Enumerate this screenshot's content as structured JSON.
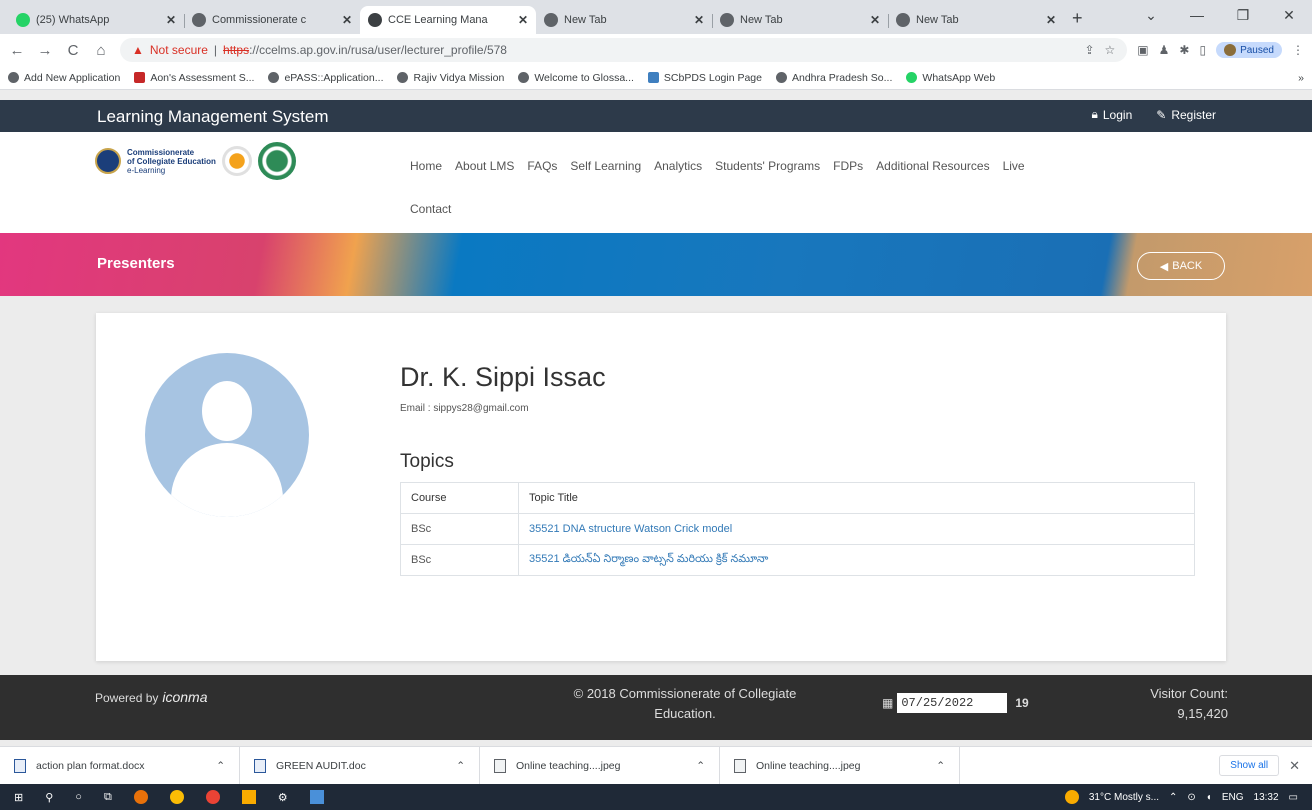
{
  "browser": {
    "tabs": [
      {
        "title": "(25) WhatsApp",
        "active": false
      },
      {
        "title": "Commissionerate c",
        "active": false
      },
      {
        "title": "CCE Learning Mana",
        "active": true
      },
      {
        "title": "New Tab",
        "active": false
      },
      {
        "title": "New Tab",
        "active": false
      },
      {
        "title": "New Tab",
        "active": false
      }
    ],
    "new_tab": "+",
    "window_controls": {
      "chevron": "⌄",
      "minimize": "—",
      "restore": "❐",
      "close": "✕"
    },
    "nav": {
      "back": "←",
      "forward": "→",
      "reload": "C",
      "home": "⌂"
    },
    "address": {
      "warning_icon": "▲",
      "not_secure": "Not secure",
      "separator": "|",
      "scheme": "https",
      "rest": "://ccelms.ap.gov.in/rusa/user/lecturer_profile/578"
    },
    "paused_label": "Paused",
    "bookmarks": [
      "Add New Application",
      "Aon's Assessment S...",
      "ePASS::Application...",
      "Rajiv Vidya Mission",
      "Welcome to Glossa...",
      "SCbPDS Login Page",
      "Andhra Pradesh So...",
      "WhatsApp Web"
    ],
    "bookmarks_more": "»"
  },
  "site": {
    "brand": "Learning Management System",
    "login": "Login",
    "register": "Register",
    "logo_text": [
      "Commissionerate",
      "of Collegiate Education",
      "e-Learning"
    ],
    "menu": [
      "Home",
      "About LMS",
      "FAQs",
      "Self Learning",
      "Analytics",
      "Students' Programs",
      "FDPs",
      "Additional Resources",
      "Live"
    ],
    "menu_second_line": "Contact"
  },
  "banner": {
    "title": "Presenters",
    "back_label": "BACK"
  },
  "profile": {
    "name": "Dr. K. Sippi Issac",
    "email": "Email : sippys28@gmail.com",
    "topics_heading": "Topics",
    "table": {
      "headers": [
        "Course",
        "Topic Title"
      ],
      "rows": [
        {
          "course": "BSc",
          "topic": "35521 DNA structure Watson Crick model"
        },
        {
          "course": "BSc",
          "topic": "35521 డియన్ఏ నిర్మాణం వాట్సన్ మరియు క్రిక్ నమూనా"
        }
      ]
    }
  },
  "footer": {
    "powered_by": "Powered by",
    "powered_brand": "iconma",
    "copyright_line1": "© 2018 Commissionerate of Collegiate",
    "copyright_line2": "Education.",
    "date": "07/25/2022",
    "day": "19",
    "visitor_label": "Visitor Count:",
    "visitor_count": "9,15,420"
  },
  "downloads": {
    "items": [
      "action plan format.docx",
      "GREEN AUDIT.doc",
      "Online teaching....jpeg",
      "Online teaching....jpeg"
    ],
    "show_all": "Show all",
    "close": "✕"
  },
  "taskbar": {
    "weather": "31°C  Mostly s...",
    "lang": "ENG",
    "time": "13:32"
  }
}
